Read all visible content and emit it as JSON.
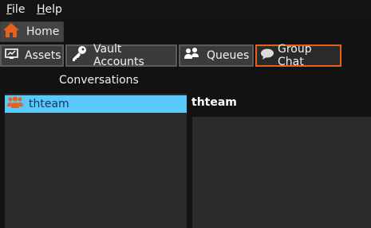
{
  "menu": {
    "file": "File",
    "help": "Help"
  },
  "home_tab": {
    "label": "Home"
  },
  "tabs": [
    {
      "label": "Assets",
      "icon": "monitor-icon"
    },
    {
      "label": "Vault Accounts",
      "icon": "key-icon"
    },
    {
      "label": "Queues",
      "icon": "users-icon"
    },
    {
      "label": "Group Chat",
      "icon": "chat-bubble-icon",
      "active": true
    }
  ],
  "panel": {
    "title": "Conversations",
    "conversations": [
      {
        "name": "thteam",
        "icon": "group-icon",
        "selected": true
      }
    ]
  },
  "chat": {
    "title": "thteam"
  },
  "colors": {
    "accent": "#e8601c",
    "selection": "#5ac8fa",
    "background": "#121212",
    "panel": "#2b2b2b"
  }
}
